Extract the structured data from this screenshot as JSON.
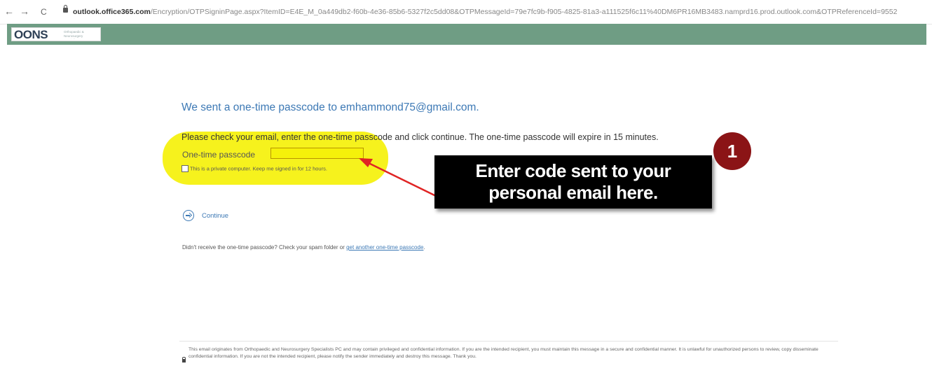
{
  "browser": {
    "back": "←",
    "forward": "→",
    "reload": "C",
    "url_host": "outlook.office365.com",
    "url_path": "/Encryption/OTPSigninPage.aspx?ItemID=E4E_M_0a449db2-f60b-4e36-85b6-5327f2c5dd08&OTPMessageId=79e7fc9b-f905-4825-81a3-a111525f6c11%40DM6PR16MB3483.namprd16.prod.outlook.com&OTPReferenceId=9552"
  },
  "header": {
    "logo_text": "OONS",
    "logo_subtext": "Orthopaedic & Neurosurgery Specialists"
  },
  "main": {
    "title": "We sent a one-time passcode to emhammond75@gmail.com.",
    "instructions": "Please check your email, enter the one-time passcode and click continue. The one-time passcode will expire in 15 minutes.",
    "otp_label": "One-time passcode",
    "otp_value": "",
    "keep_signed_in": "This is a private computer. Keep me signed in for 12 hours.",
    "continue_label": "Continue",
    "resend_text": "Didn't receive the one-time passcode? Check your spam folder or ",
    "resend_link": "get another one-time passcode",
    "resend_end": "."
  },
  "annotation": {
    "callout_line1": "Enter code sent to your",
    "callout_line2": "personal email here.",
    "badge_number": "1",
    "highlight_color": "#f5f10a",
    "arrow_color": "#e02424",
    "badge_color": "#8b1416"
  },
  "footer": {
    "disclaimer": "This email originates from Orthopaedic and Neurosurgery Specialists PC and may contain privileged and confidential information. If you are the intended recipient, you must maintain this message in a secure and confidential manner. It is unlawful for unauthorized persons to review, copy disseminate confidential information. If you are not the intended recipient, please notify the sender immediately and destroy this message. Thank you."
  },
  "colors": {
    "header_bg": "#6f9d84",
    "link": "#3d79b5"
  }
}
